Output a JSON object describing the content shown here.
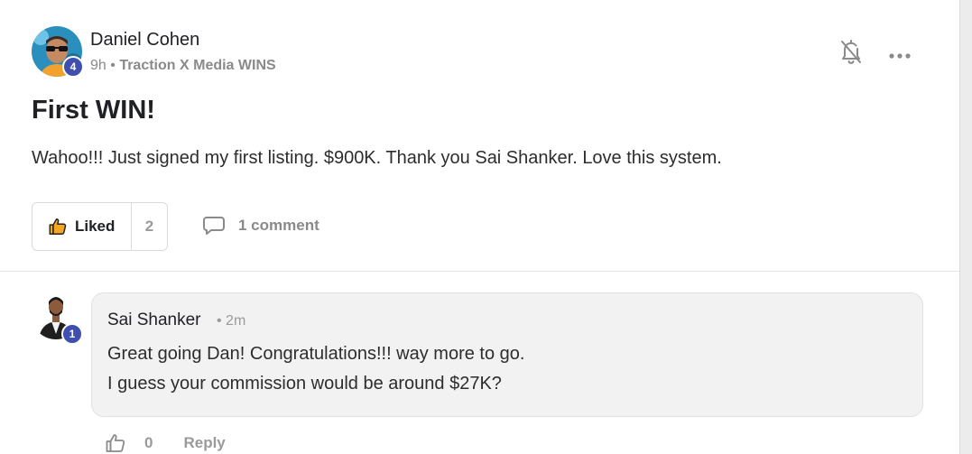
{
  "post": {
    "author": "Daniel Cohen",
    "author_level": "4",
    "time": "9h",
    "separator": "•",
    "group": "Traction X Media WINS",
    "title": "First WIN!",
    "body": "Wahoo!!! Just signed my first listing. $900K. Thank you Sai Shanker. Love this system.",
    "like_label": "Liked",
    "like_count": "2",
    "comment_label": "1 comment"
  },
  "comment": {
    "author": "Sai Shanker",
    "author_level": "1",
    "time": "• 2m",
    "lines": [
      "Great going Dan! Congratulations!!! way more to go.",
      "I guess your commission would be around $27K?"
    ],
    "like_count": "0",
    "reply_label": "Reply"
  },
  "icons": {
    "mute": "bell-off-icon",
    "more": "more-horizontal-icon",
    "like": "thumbs-up-icon",
    "comment": "speech-bubble-icon"
  },
  "colors": {
    "badge": "#3e4fb0",
    "muted_text": "#8a8a8a",
    "comment_bg": "#f2f2f2",
    "liked_icon": "#f5a623"
  }
}
